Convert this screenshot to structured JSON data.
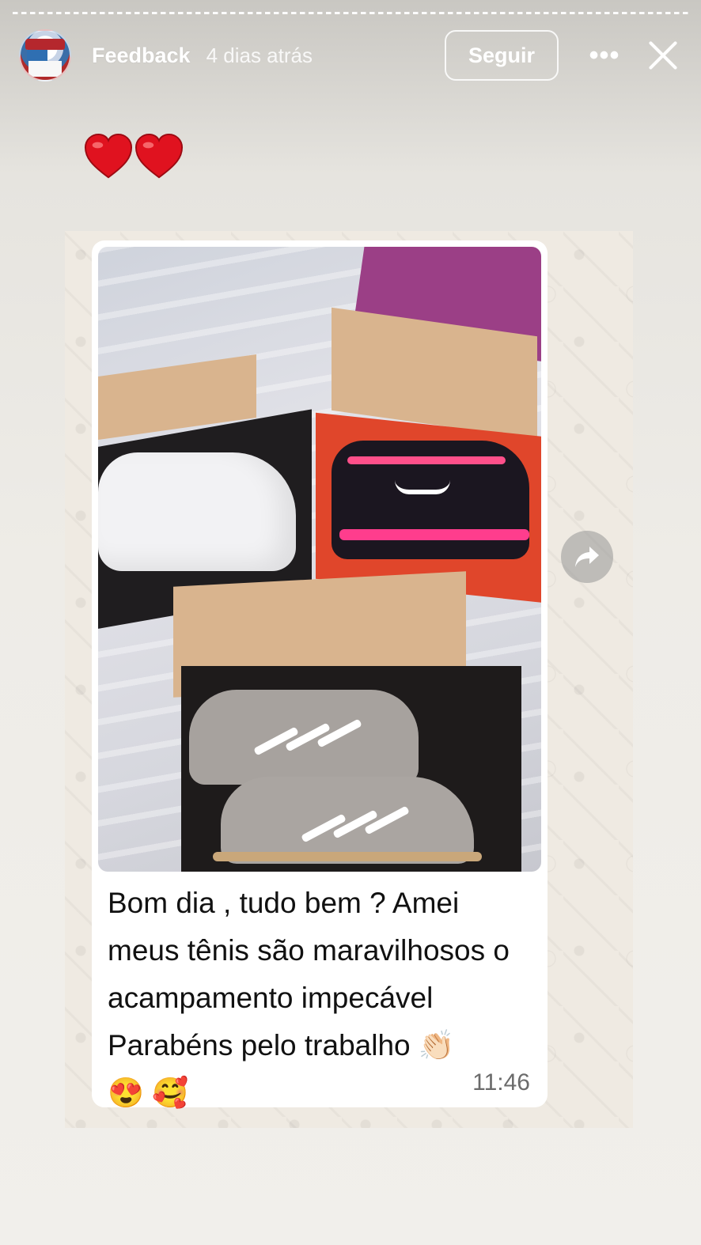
{
  "story": {
    "progress_segments": 1,
    "progress_fraction": 0.0
  },
  "header": {
    "avatar_icon": "avatar-sneaker-box",
    "username": "Feedback",
    "time": "4 dias atrás",
    "follow_label": "Seguir",
    "more_icon": "more-icon",
    "more_glyph": "•••",
    "close_icon": "close-icon"
  },
  "sticker": {
    "hearts": [
      "❤️",
      "❤️"
    ],
    "heart_color": "#e0121f"
  },
  "chat": {
    "message": "Bom dia , tudo bem ? Amei meus tênis são maravilhosos o acampamento impecável Parabéns pelo trabalho 👏🏻",
    "emojis": "😍 🥰",
    "time": "11:46",
    "photo_description_icon": "photo-sneaker-boxes",
    "forward_icon": "forward-icon"
  },
  "colors": {
    "bubble_bg": "#ffffff",
    "chat_wallpaper": "#efeae2",
    "text": "#111111",
    "time_text": "#6b6b6b"
  }
}
